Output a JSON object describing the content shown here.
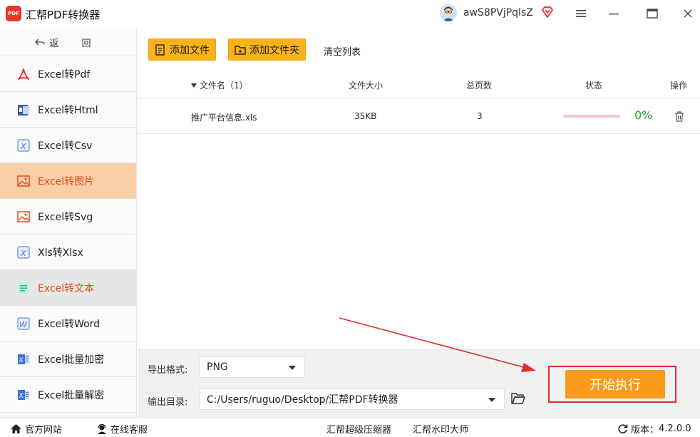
{
  "app": {
    "title": "汇帮PDF转换器",
    "logo_text": "PDF",
    "user_name": "awS8PVjPqlsZ"
  },
  "sidebar": {
    "back_label": "返 回",
    "items": [
      {
        "label": "Excel转Pdf",
        "icon": "pdf-icon"
      },
      {
        "label": "Excel转Html",
        "icon": "html-icon"
      },
      {
        "label": "Excel转Csv",
        "icon": "excel-icon"
      },
      {
        "label": "Excel转图片",
        "icon": "image-icon"
      },
      {
        "label": "Excel转Svg",
        "icon": "image-icon"
      },
      {
        "label": "Xls转Xlsx",
        "icon": "excel-icon"
      },
      {
        "label": "Excel转文本",
        "icon": "text-doc-icon"
      },
      {
        "label": "Excel转Word",
        "icon": "word-icon"
      },
      {
        "label": "Excel批量加密",
        "icon": "excel-lock-icon"
      },
      {
        "label": "Excel批量解密",
        "icon": "excel-unlock-icon"
      }
    ],
    "active_index": 3,
    "hover_index": 6
  },
  "toolbar": {
    "add_file": "添加文件",
    "add_folder": "添加文件夹",
    "clear_list": "清空列表"
  },
  "table": {
    "columns": {
      "name": "文件名（1）",
      "size": "文件大小",
      "pages": "总页数",
      "status": "状态",
      "action": "操作"
    },
    "rows": [
      {
        "name": "推广平台信息.xls",
        "size": "35KB",
        "pages": "3",
        "progress": 0,
        "progress_text": "0%"
      }
    ]
  },
  "panel": {
    "format_label": "导出格式:",
    "format_value": "PNG",
    "dir_label": "输出目录:",
    "dir_value": "C:/Users/ruguo/Desktop/汇帮PDF转换器",
    "start_label": "开始执行"
  },
  "footer": {
    "website": "官方网站",
    "support": "在线客服",
    "compressor": "汇帮超级压缩器",
    "watermark": "汇帮水印大师",
    "version_label": "版本：",
    "version": "4.2.0.0"
  },
  "colors": {
    "accent_orange": "#f9b21c",
    "start_button": "#f99a1b",
    "active_item_bg": "#f8cfa6",
    "active_item_text": "#e8481f",
    "highlight_red": "#e02d2d",
    "progress_green": "#1aa22a"
  }
}
